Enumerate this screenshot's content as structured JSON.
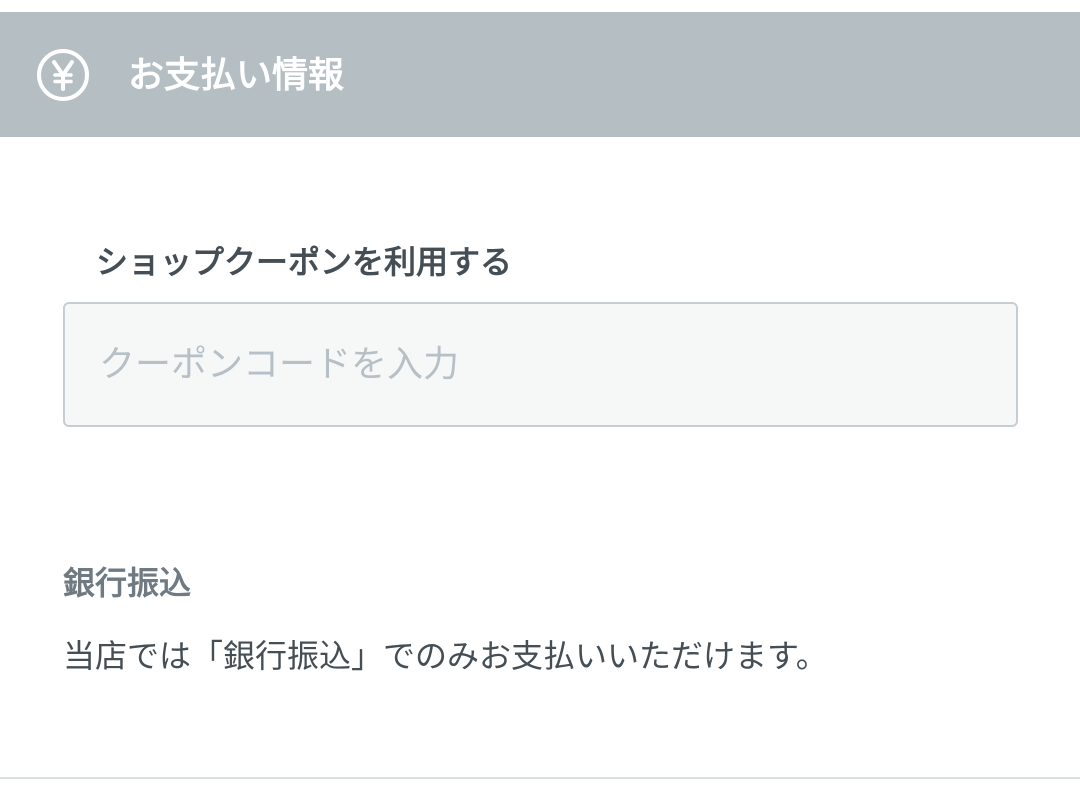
{
  "header": {
    "title": "お支払い情報",
    "icon": "yen-circle-icon"
  },
  "coupon": {
    "label": "ショップクーポンを利用する",
    "placeholder": "クーポンコードを入力",
    "value": ""
  },
  "bank_transfer": {
    "title": "銀行振込",
    "description": "当店では「銀行振込」でのみお支払いいただけます。"
  },
  "colors": {
    "header_bg": "#b5bec3",
    "header_text": "#ffffff",
    "label_text": "#454e55",
    "muted_text": "#6f7a82",
    "input_bg": "#f6f8f8",
    "input_border": "#c6ced3",
    "placeholder": "#b7c0c6"
  }
}
